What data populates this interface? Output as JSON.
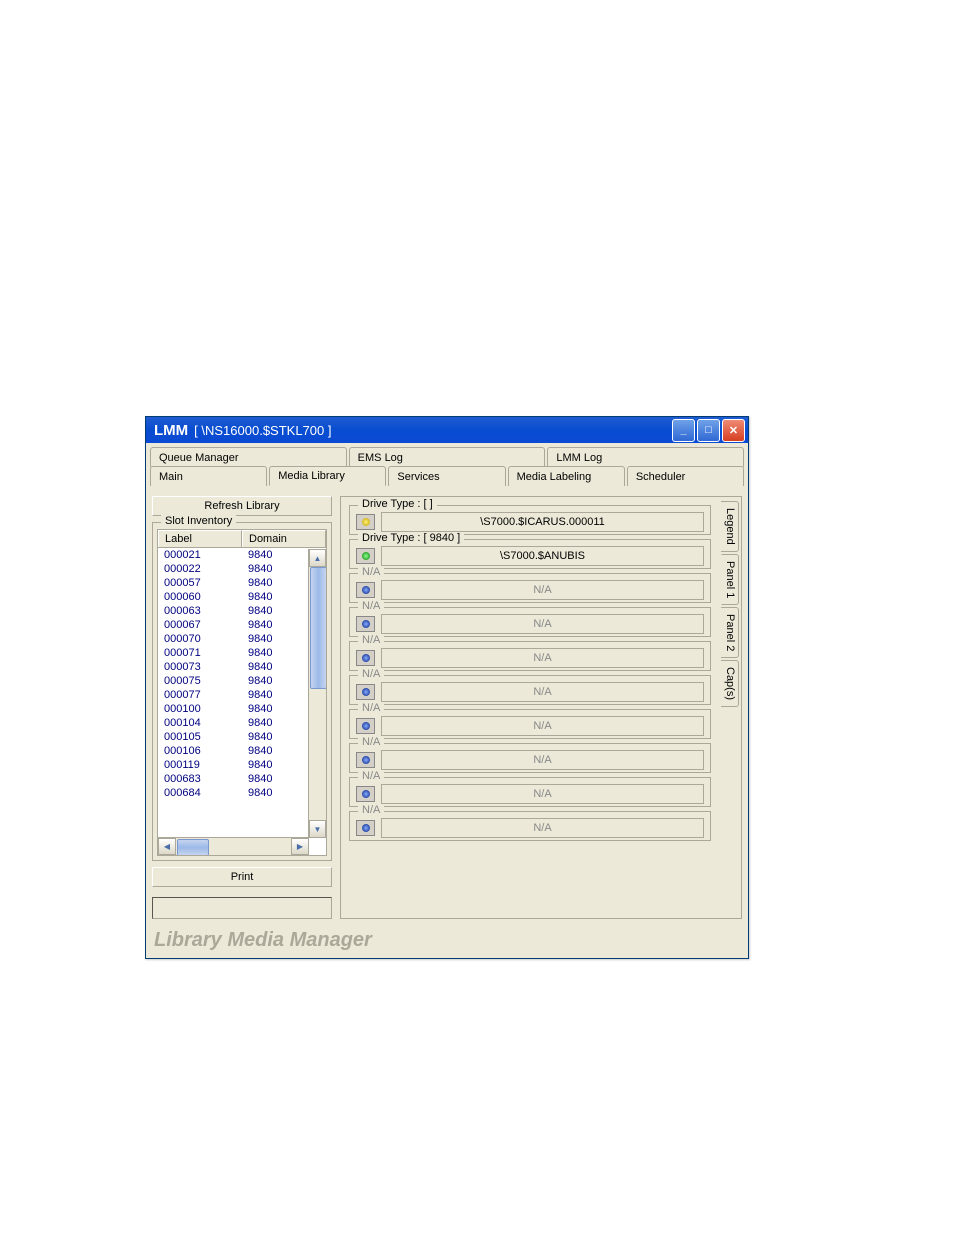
{
  "title": {
    "app": "LMM",
    "sub": "[ \\NS16000.$STKL700 ]"
  },
  "tabs": {
    "top": [
      "Queue Manager",
      "EMS Log",
      "LMM Log"
    ],
    "bot": [
      "Main",
      "Media Library",
      "Services",
      "Media Labeling",
      "Scheduler"
    ]
  },
  "left": {
    "refresh": "Refresh Library",
    "slotLegend": "Slot Inventory",
    "cols": [
      "Label",
      "Domain"
    ],
    "print": "Print"
  },
  "rows": [
    [
      "000021",
      "9840"
    ],
    [
      "000022",
      "9840"
    ],
    [
      "000057",
      "9840"
    ],
    [
      "000060",
      "9840"
    ],
    [
      "000063",
      "9840"
    ],
    [
      "000067",
      "9840"
    ],
    [
      "000070",
      "9840"
    ],
    [
      "000071",
      "9840"
    ],
    [
      "000073",
      "9840"
    ],
    [
      "000075",
      "9840"
    ],
    [
      "000077",
      "9840"
    ],
    [
      "000100",
      "9840"
    ],
    [
      "000104",
      "9840"
    ],
    [
      "000105",
      "9840"
    ],
    [
      "000106",
      "9840"
    ],
    [
      "000119",
      "9840"
    ],
    [
      "000683",
      "9840"
    ],
    [
      "000684",
      "9840"
    ]
  ],
  "drives": [
    {
      "legend": "Drive Type : [  ]",
      "led": "y",
      "val": "\\S7000.$ICARUS.000011",
      "active": true,
      "first": true
    },
    {
      "legend": "Drive Type : [ 9840 ]",
      "led": "g",
      "val": "\\S7000.$ANUBIS",
      "active": true,
      "first": true
    },
    {
      "legend": "N/A",
      "led": "b",
      "val": "N/A",
      "active": false
    },
    {
      "legend": "N/A",
      "led": "b",
      "val": "N/A",
      "active": false
    },
    {
      "legend": "N/A",
      "led": "b",
      "val": "N/A",
      "active": false
    },
    {
      "legend": "N/A",
      "led": "b",
      "val": "N/A",
      "active": false
    },
    {
      "legend": "N/A",
      "led": "b",
      "val": "N/A",
      "active": false
    },
    {
      "legend": "N/A",
      "led": "b",
      "val": "N/A",
      "active": false
    },
    {
      "legend": "N/A",
      "led": "b",
      "val": "N/A",
      "active": false
    },
    {
      "legend": "N/A",
      "led": "b",
      "val": "N/A",
      "active": false
    }
  ],
  "side": [
    "Legend",
    "Panel 1",
    "Panel 2",
    "Cap(s)"
  ],
  "footer": "Library Media Manager"
}
